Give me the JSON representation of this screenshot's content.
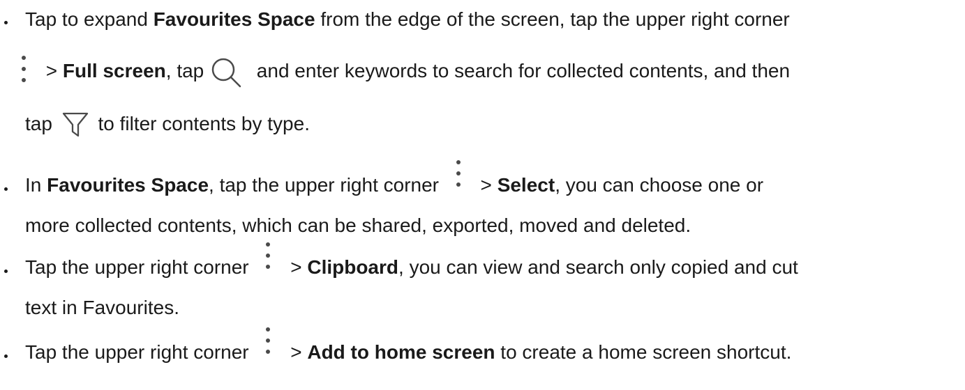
{
  "items": [
    {
      "line1": {
        "t1": "Tap to expand ",
        "b1": "Favourites Space",
        "t2": " from the edge of the screen, tap the upper right corner"
      },
      "line2": {
        "t1": " > ",
        "b1": "Full screen",
        "t2": ", tap ",
        "t3": " and enter keywords to search for collected contents, and then"
      },
      "line3": {
        "t1": "tap ",
        "t2": " to filter contents by type."
      }
    },
    {
      "line1": {
        "t1": "In ",
        "b1": "Favourites Space",
        "t2": ", tap the upper right corner ",
        "t3": " > ",
        "b2": "Select",
        "t4": ", you can choose one or"
      },
      "line2": {
        "t1": "more collected contents, which can be shared, exported, moved and deleted."
      }
    },
    {
      "line1": {
        "t1": "Tap the upper right corner ",
        "t2": " > ",
        "b1": "Clipboard",
        "t3": ", you can view and search only copied and cut"
      },
      "line2": {
        "t1": "text in Favourites."
      }
    },
    {
      "line1": {
        "t1": "Tap the upper right corner ",
        "t2": " > ",
        "b1": "Add to home screen",
        "t3": " to create a home screen shortcut."
      }
    }
  ],
  "icons": {
    "more": "more-vertical-icon",
    "search": "search-icon",
    "filter": "filter-icon"
  }
}
